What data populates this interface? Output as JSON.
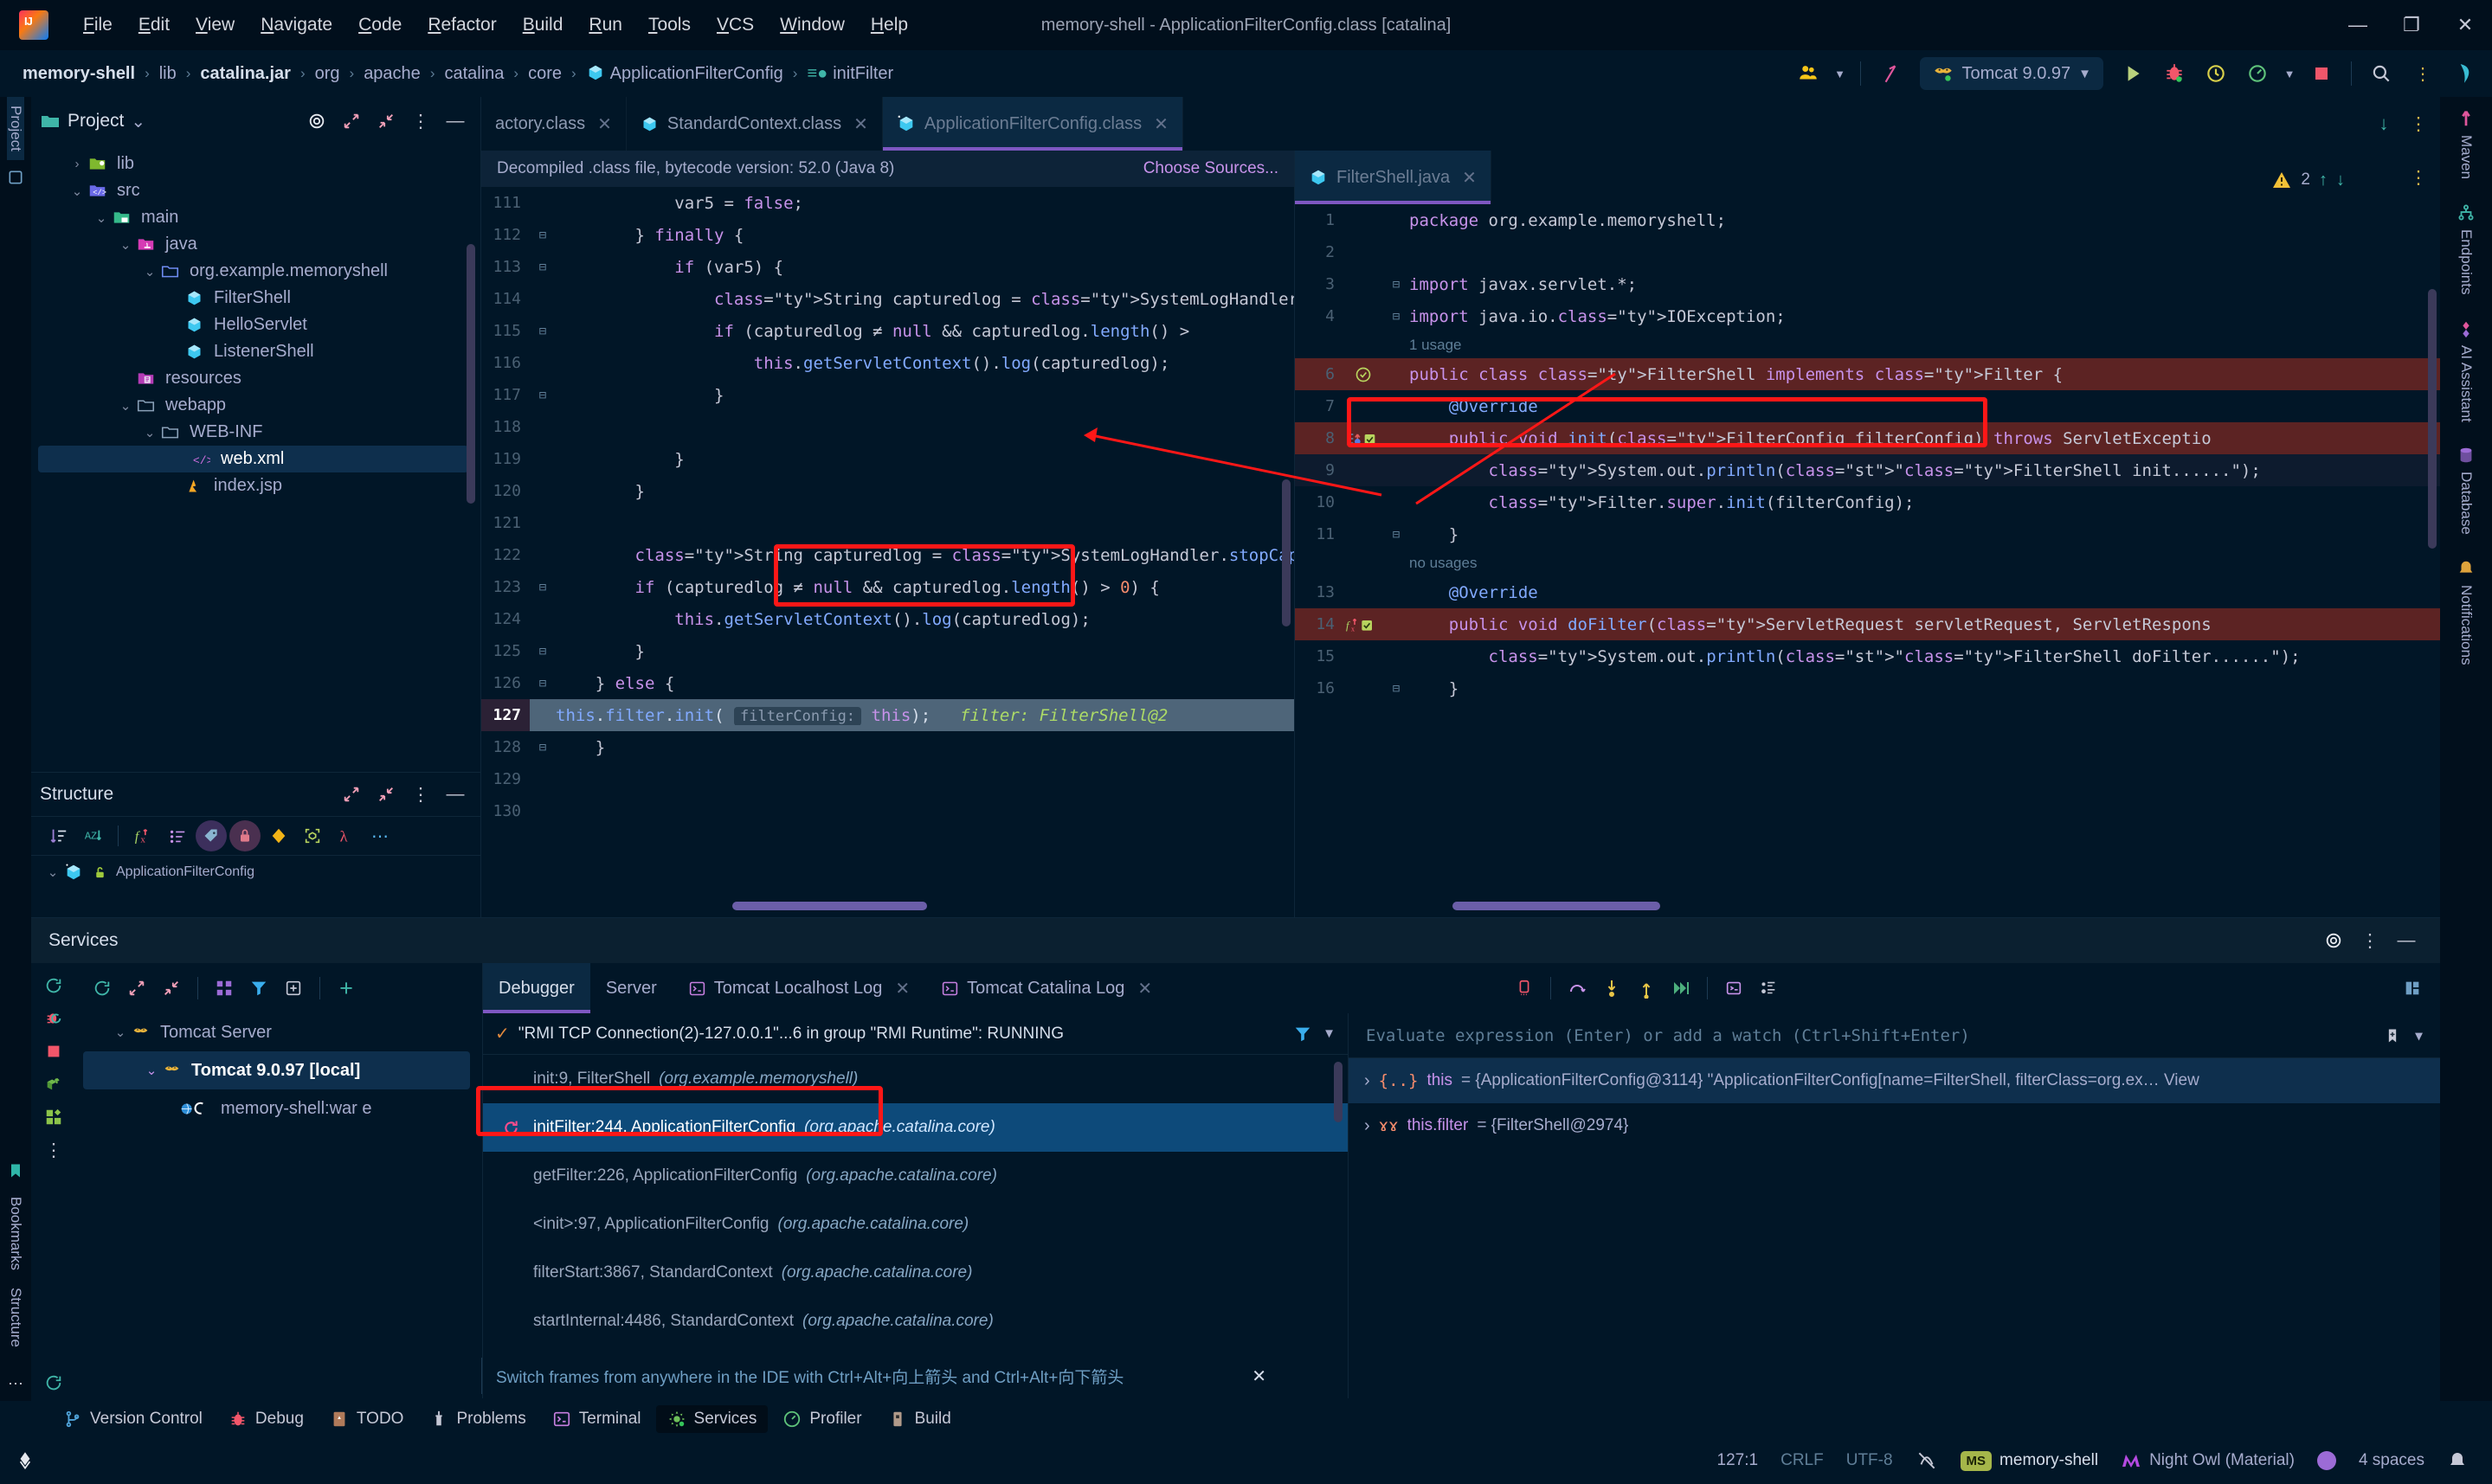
{
  "window": {
    "title": "memory-shell - ApplicationFilterConfig.class [catalina]",
    "minimize": "—",
    "maximize": "❐",
    "close": "✕"
  },
  "menu": {
    "items": [
      "File",
      "Edit",
      "View",
      "Navigate",
      "Code",
      "Refactor",
      "Build",
      "Run",
      "Tools",
      "VCS",
      "Window",
      "Help"
    ]
  },
  "breadcrumb": {
    "items": [
      "memory-shell",
      "lib",
      "catalina.jar",
      "org",
      "apache",
      "catalina",
      "core",
      "ApplicationFilterConfig",
      "initFilter"
    ],
    "separator": "›"
  },
  "toolbar": {
    "run_config": "Tomcat 9.0.97",
    "chevron": "▼",
    "run_label": "Run",
    "debug_label": "Debug",
    "rerun_label": "Rerun",
    "profile_label": "Profile",
    "stop_label": "Stop",
    "search_label": "Search Everywhere",
    "more_label": "⋮"
  },
  "left_strip": {
    "project_tab": "Project",
    "bookmarks_tab": "Bookmarks",
    "structure_tab": "Structure"
  },
  "right_strip": {
    "tabs": [
      "Maven",
      "Endpoints",
      "AI Assistant",
      "Database",
      "Notifications"
    ]
  },
  "project_panel": {
    "title": "Project",
    "chevron": "⌄",
    "tree": [
      {
        "label": "lib",
        "indent": 1,
        "twist": "›",
        "icon": "folder-lib",
        "selected": false
      },
      {
        "label": "src",
        "indent": 1,
        "twist": "⌄",
        "icon": "folder-src",
        "selected": false
      },
      {
        "label": "main",
        "indent": 2,
        "twist": "⌄",
        "icon": "folder-main",
        "selected": false
      },
      {
        "label": "java",
        "indent": 3,
        "twist": "⌄",
        "icon": "folder-java",
        "selected": false
      },
      {
        "label": "org.example.memoryshell",
        "indent": 4,
        "twist": "⌄",
        "icon": "folder-package",
        "selected": false
      },
      {
        "label": "FilterShell",
        "indent": 5,
        "twist": "",
        "icon": "java-class",
        "selected": false
      },
      {
        "label": "HelloServlet",
        "indent": 5,
        "twist": "",
        "icon": "java-class",
        "selected": false
      },
      {
        "label": "ListenerShell",
        "indent": 5,
        "twist": "",
        "icon": "java-class",
        "selected": false
      },
      {
        "label": "resources",
        "indent": 3,
        "twist": "",
        "icon": "folder-resources",
        "selected": false
      },
      {
        "label": "webapp",
        "indent": 3,
        "twist": "⌄",
        "icon": "folder-plain",
        "selected": false
      },
      {
        "label": "WEB-INF",
        "indent": 4,
        "twist": "⌄",
        "icon": "folder-plain",
        "selected": false
      },
      {
        "label": "web.xml",
        "indent": 5,
        "twist": "",
        "icon": "xml-file",
        "selected": true
      },
      {
        "label": "index.jsp",
        "indent": 5,
        "twist": "",
        "icon": "jsp-file",
        "selected": false
      }
    ]
  },
  "structure_panel": {
    "title": "Structure",
    "root_item": "ApplicationFilterConfig"
  },
  "editor_tabs": [
    {
      "label": "actory.class",
      "icon": "java-class",
      "active": false,
      "clipped": true
    },
    {
      "label": "StandardContext.class",
      "icon": "java-class",
      "active": false,
      "clipped": false
    },
    {
      "label": "ApplicationFilterConfig.class",
      "icon": "java-class-decompiled",
      "active": true,
      "clipped": false
    }
  ],
  "editor_left": {
    "notice": "Decompiled .class file, bytecode version: 52.0 (Java 8)",
    "notice_link": "Choose Sources...",
    "lines": [
      {
        "num": "111",
        "fold": "",
        "text": "            var5 = false;",
        "state": "partial"
      },
      {
        "num": "112",
        "fold": "⊟",
        "text": "        } finally {",
        "state": ""
      },
      {
        "num": "113",
        "fold": "⊟",
        "text": "            if (var5) {",
        "state": ""
      },
      {
        "num": "114",
        "fold": "",
        "text": "                String capturedlog = SystemLogHandler.stopCapture",
        "state": ""
      },
      {
        "num": "115",
        "fold": "⊟",
        "text": "                if (capturedlog ≠ null && capturedlog.length() >",
        "state": ""
      },
      {
        "num": "116",
        "fold": "",
        "text": "                    this.getServletContext().log(capturedlog);",
        "state": ""
      },
      {
        "num": "117",
        "fold": "⊟",
        "text": "                }",
        "state": ""
      },
      {
        "num": "118",
        "fold": "",
        "text": "",
        "state": ""
      },
      {
        "num": "119",
        "fold": "",
        "text": "            }",
        "state": ""
      },
      {
        "num": "120",
        "fold": "",
        "text": "        }",
        "state": ""
      },
      {
        "num": "121",
        "fold": "",
        "text": "",
        "state": ""
      },
      {
        "num": "122",
        "fold": "",
        "text": "        String capturedlog = SystemLogHandler.stopCapture();",
        "state": ""
      },
      {
        "num": "123",
        "fold": "⊟",
        "text": "        if (capturedlog ≠ null && capturedlog.length() > 0) {",
        "state": ""
      },
      {
        "num": "124",
        "fold": "",
        "text": "            this.getServletContext().log(capturedlog);",
        "state": ""
      },
      {
        "num": "125",
        "fold": "⊟",
        "text": "        }",
        "state": ""
      },
      {
        "num": "126",
        "fold": "⊟",
        "text": "    } else {",
        "state": ""
      },
      {
        "num": "127",
        "fold": "",
        "text": "        this.filter.init( filterConfig: this);",
        "state": "executing",
        "inlay": "filter: FilterShell@2"
      },
      {
        "num": "128",
        "fold": "⊟",
        "text": "    }",
        "state": ""
      },
      {
        "num": "129",
        "fold": "",
        "text": "",
        "state": ""
      },
      {
        "num": "130",
        "fold": "",
        "text": "",
        "state": ""
      }
    ],
    "hint_param": "filterConfig:",
    "highlight_line": "127"
  },
  "editor_right": {
    "tab_label": "FilterShell.java",
    "warning_count": "2",
    "lines": [
      {
        "num": "1",
        "text": "package org.example.memoryshell;",
        "state": ""
      },
      {
        "num": "2",
        "text": "",
        "state": ""
      },
      {
        "num": "3",
        "text": "import javax.servlet.*;",
        "fold": "⊟",
        "state": ""
      },
      {
        "num": "4",
        "text": "import java.io.IOException;",
        "fold": "⊟",
        "state": ""
      },
      {
        "num": "5",
        "text": "",
        "state": "",
        "usage": "1 usage"
      },
      {
        "num": "6",
        "text": "public class FilterShell implements Filter {",
        "state": "err"
      },
      {
        "num": "7",
        "text": "    @Override",
        "state": ""
      },
      {
        "num": "8",
        "text": "    public void init(FilterConfig filterConfig) throws ServletExceptio",
        "state": "err"
      },
      {
        "num": "9",
        "text": "        System.out.println(\"FilterShell init......\");",
        "state": "cur"
      },
      {
        "num": "10",
        "text": "        Filter.super.init(filterConfig);",
        "state": ""
      },
      {
        "num": "11",
        "text": "    }",
        "fold": "⊟",
        "state": ""
      },
      {
        "num": "12",
        "text": "",
        "state": "",
        "usage": "no usages"
      },
      {
        "num": "13",
        "text": "    @Override",
        "state": ""
      },
      {
        "num": "14",
        "text": "    public void doFilter(ServletRequest servletRequest, ServletRespons",
        "state": "err"
      },
      {
        "num": "15",
        "text": "        System.out.println(\"FilterShell doFilter......\");",
        "state": ""
      },
      {
        "num": "16",
        "text": "    }",
        "fold": "⊟",
        "state": ""
      }
    ]
  },
  "services": {
    "title": "Services",
    "tree": [
      {
        "label": "Tomcat Server",
        "indent": 1,
        "twist": "⌄",
        "icon": "tomcat",
        "selected": false,
        "bold": false
      },
      {
        "label": "Tomcat 9.0.97 [local]",
        "indent": 2,
        "twist": "⌄",
        "icon": "tomcat",
        "selected": true,
        "bold": true
      },
      {
        "label": "memory-shell:war e",
        "indent": 3,
        "twist": "",
        "icon": "globe-spinner",
        "selected": false,
        "bold": false
      }
    ],
    "tabs": [
      {
        "label": "Debugger",
        "icon": "",
        "active": true,
        "closable": false
      },
      {
        "label": "Server",
        "icon": "",
        "active": false,
        "closable": false
      },
      {
        "label": "Tomcat Localhost Log",
        "icon": "console",
        "active": false,
        "closable": true
      },
      {
        "label": "Tomcat Catalina Log",
        "icon": "console",
        "active": false,
        "closable": true
      }
    ],
    "thread": "\"RMI TCP Connection(2)-127.0.0.1\"...6 in group \"RMI Runtime\": RUNNING",
    "frames": [
      {
        "method": "init:9, FilterShell",
        "pkg": "(org.example.memoryshell)",
        "selected": false,
        "icon": ""
      },
      {
        "method": "initFilter:244, ApplicationFilterConfig",
        "pkg": "(org.apache.catalina.core)",
        "selected": true,
        "icon": "recursion"
      },
      {
        "method": "getFilter:226, ApplicationFilterConfig",
        "pkg": "(org.apache.catalina.core)",
        "selected": false,
        "icon": ""
      },
      {
        "method": "<init>:97, ApplicationFilterConfig",
        "pkg": "(org.apache.catalina.core)",
        "selected": false,
        "icon": ""
      },
      {
        "method": "filterStart:3867, StandardContext",
        "pkg": "(org.apache.catalina.core)",
        "selected": false,
        "icon": ""
      },
      {
        "method": "startInternal:4486, StandardContext",
        "pkg": "(org.apache.catalina.core)",
        "selected": false,
        "icon": ""
      }
    ],
    "eval_placeholder": "Evaluate expression (Enter) or add a watch (Ctrl+Shift+Enter)",
    "watches": [
      {
        "arrow": "›",
        "badge": "{..}",
        "name": "this",
        "value": "= {ApplicationFilterConfig@3114} \"ApplicationFilterConfig[name=FilterShell, filterClass=org.ex… View",
        "selected": true
      },
      {
        "arrow": "›",
        "badge": "ɤɤ",
        "name": "this.filter",
        "value": "= {FilterShell@2974}",
        "selected": false
      }
    ],
    "hint": "Switch frames from anywhere in the IDE with Ctrl+Alt+向上箭头 and Ctrl+Alt+向下箭头",
    "hint_close": "✕"
  },
  "toolwindow_bar": [
    {
      "label": "Version Control",
      "icon": "branch",
      "active": false
    },
    {
      "label": "Debug",
      "icon": "bug",
      "active": false
    },
    {
      "label": "TODO",
      "icon": "todo",
      "active": false
    },
    {
      "label": "Problems",
      "icon": "problems",
      "active": false
    },
    {
      "label": "Terminal",
      "icon": "terminal",
      "active": false
    },
    {
      "label": "Services",
      "icon": "services",
      "active": true
    },
    {
      "label": "Profiler",
      "icon": "profiler",
      "active": false
    },
    {
      "label": "Build",
      "icon": "build",
      "active": false
    }
  ],
  "statusbar": {
    "caret": "127:1",
    "line_sep": "CRLF",
    "encoding": "UTF-8",
    "inspection": "inspection-off-icon",
    "branch_badge": "MS",
    "branch": "memory-shell",
    "theme": "Night Owl (Material)",
    "indent": "4 spaces"
  },
  "colors": {
    "accent_purple": "#7e57c2",
    "annotation_red": "#ff1717",
    "selection_blue": "#0d4a7a",
    "error_bg": "#5c2323",
    "exec_line": "#4e6579",
    "bg": "#011627"
  }
}
